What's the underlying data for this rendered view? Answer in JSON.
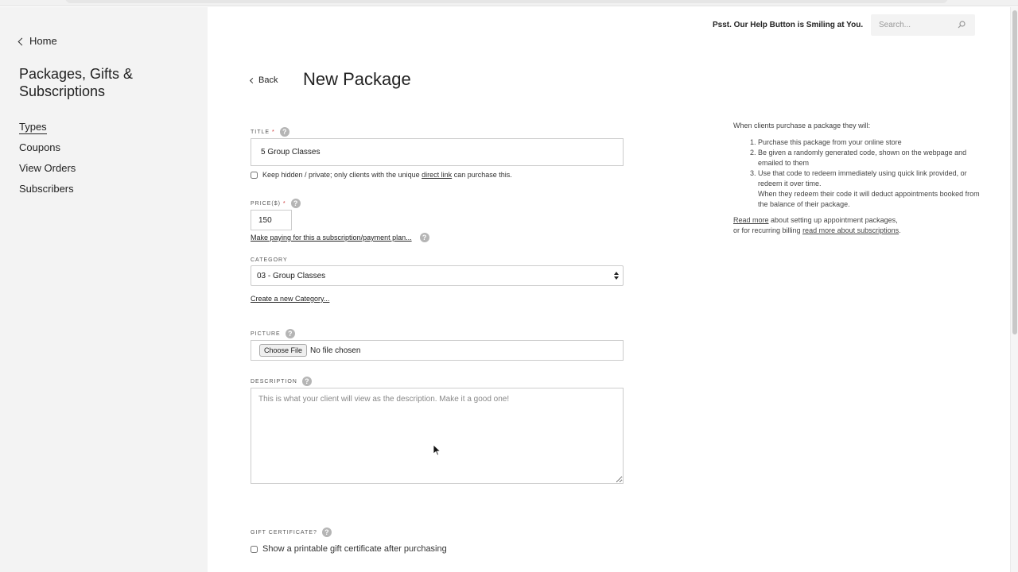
{
  "sidebar": {
    "home_label": "Home",
    "title": "Packages, Gifts & Subscriptions",
    "nav": [
      {
        "label": "Types",
        "active": true
      },
      {
        "label": "Coupons",
        "active": false
      },
      {
        "label": "View Orders",
        "active": false
      },
      {
        "label": "Subscribers",
        "active": false
      }
    ]
  },
  "header": {
    "help_text": "Psst. Our Help Button is Smiling at You.",
    "search_placeholder": "Search..."
  },
  "page": {
    "back_label": "Back",
    "title": "New Package"
  },
  "form": {
    "title_label": "TITLE",
    "title_value": "5 Group Classes",
    "required_mark": "*",
    "hidden_text_before": "Keep hidden / private; only clients with the unique",
    "hidden_link": "direct link",
    "hidden_text_after": "can purchase this.",
    "price_label": "PRICE($)",
    "price_value": "150",
    "subscription_link": "Make paying for this a subscription/payment plan...",
    "category_label": "CATEGORY",
    "category_value": "03 - Group Classes",
    "create_category_link": "Create a new Category...",
    "picture_label": "PICTURE",
    "choose_file_label": "Choose File",
    "file_status": "No file chosen",
    "description_label": "DESCRIPTION",
    "description_placeholder": "This is what your client will view as the description. Make it a good one!",
    "gift_label": "GIFT CERTIFICATE?",
    "gift_checkbox_label": "Show a printable gift certificate after purchasing",
    "help_glyph": "?"
  },
  "info": {
    "intro": "When clients purchase a package they will:",
    "steps": [
      "Purchase this package from your online store",
      "Be given a randomly generated code, shown on the webpage and emailed to them",
      "Use that code to redeem immediately using quick link provided, or redeem it over time.",
      "When they redeem their code it will deduct appointments booked from the balance of their package."
    ],
    "read_more_link": "Read more",
    "read_more_text": "about setting up appointment packages,",
    "recurring_text": "or for recurring billing",
    "subscriptions_link": "read more about subscriptions",
    "period": "."
  },
  "colors": {
    "sidebar_bg": "#f3f3f3",
    "required": "#cc3333",
    "help_icon": "#b5b5b5"
  }
}
